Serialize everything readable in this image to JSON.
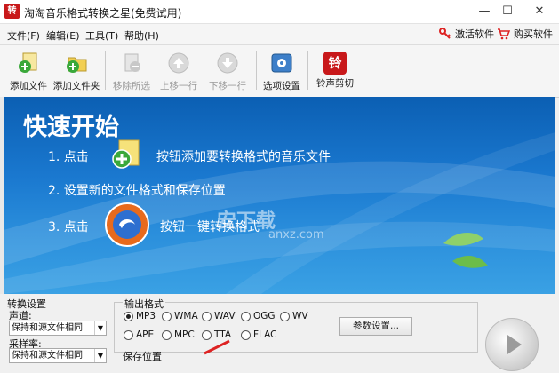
{
  "window": {
    "title": "淘淘音乐格式转换之星(免费试用)",
    "app_icon_text": "转"
  },
  "controls": {
    "minimize": "—",
    "maximize": "☐",
    "close": "✕"
  },
  "menu": {
    "items": [
      "文件(F)",
      "编辑(E)",
      "工具(T)",
      "帮助(H)"
    ],
    "activate": "激活软件",
    "buy": "购买软件"
  },
  "toolbar": {
    "add_file": "添加文件",
    "add_folder": "添加文件夹",
    "remove": "移除所选",
    "move_up": "上移一行",
    "move_down": "下移一行",
    "options": "选项设置",
    "ringtone": "铃声剪切",
    "ringtone_icon_text": "铃"
  },
  "banner": {
    "title": "快速开始",
    "step1_num": "1. 点击",
    "step1_text": "按钮添加要转换格式的音乐文件",
    "step2": "2. 设置新的文件格式和保存位置",
    "step3_num": "3. 点击",
    "step3_text": "按钮一键转换格式",
    "watermark_cn": "安下载",
    "watermark_en": "anxz.com"
  },
  "convert_settings": {
    "group_label": "转换设置",
    "channel_label": "声道:",
    "channel_value": "保持和源文件相同",
    "samplerate_label": "采样率:",
    "samplerate_value": "保持和源文件相同"
  },
  "output_format": {
    "group_label": "输出格式",
    "formats": [
      "MP3",
      "WMA",
      "WAV",
      "OGG",
      "WV",
      "APE",
      "MPC",
      "TTA",
      "FLAC"
    ],
    "selected": "MP3",
    "params_button": "参数设置...",
    "save_location_label": "保存位置"
  },
  "colors": {
    "banner_top": "#0b5fb3",
    "banner_bottom": "#3aa1e4",
    "add_green": "#3aa83a",
    "brand_red": "#c8181a"
  }
}
